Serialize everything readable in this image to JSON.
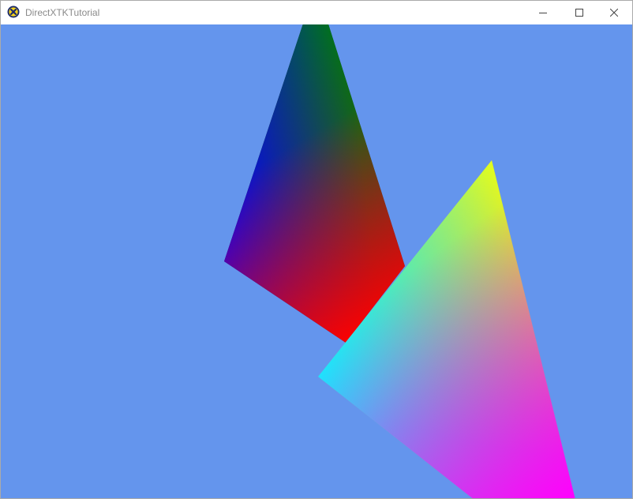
{
  "window": {
    "title": "DirectXTKTutorial",
    "app_icon": "directx-icon",
    "controls": {
      "minimize_icon": "minimize-icon",
      "maximize_icon": "maximize-icon",
      "close_icon": "close-icon"
    }
  },
  "scene": {
    "clear_color": "#6495ED",
    "triangles": [
      {
        "name": "back-triangle",
        "vertex_colors": [
          "#007F00",
          "#0000FF",
          "#FF0000"
        ]
      },
      {
        "name": "front-triangle",
        "vertex_colors": [
          "#FFFF00",
          "#00FFFF",
          "#FF00FF"
        ]
      }
    ]
  }
}
